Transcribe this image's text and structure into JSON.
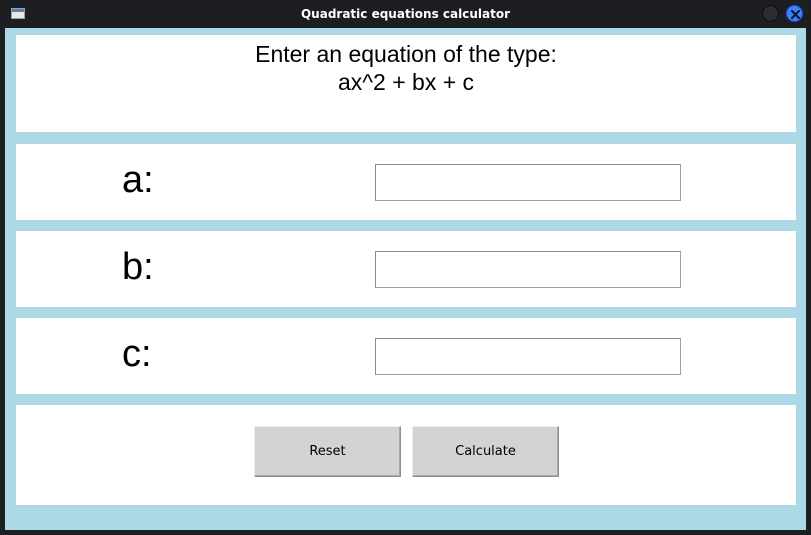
{
  "window": {
    "title": "Quadratic equations calculator",
    "icons": {
      "app": "window-app-icon",
      "minimize": "minimize-circle-icon",
      "close": "close-x-icon"
    },
    "colors": {
      "titlebar": "#1d1e22",
      "client_background": "#add8e6",
      "close_button": "#3b82f6"
    }
  },
  "header": {
    "line1": "Enter an equation of the type:",
    "line2": "ax^2 + bx + c"
  },
  "fields": {
    "a": {
      "label": "a:",
      "value": "",
      "placeholder": ""
    },
    "b": {
      "label": "b:",
      "value": "",
      "placeholder": ""
    },
    "c": {
      "label": "c:",
      "value": "",
      "placeholder": ""
    }
  },
  "buttons": {
    "reset_label": "Reset",
    "calculate_label": "Calculate"
  }
}
